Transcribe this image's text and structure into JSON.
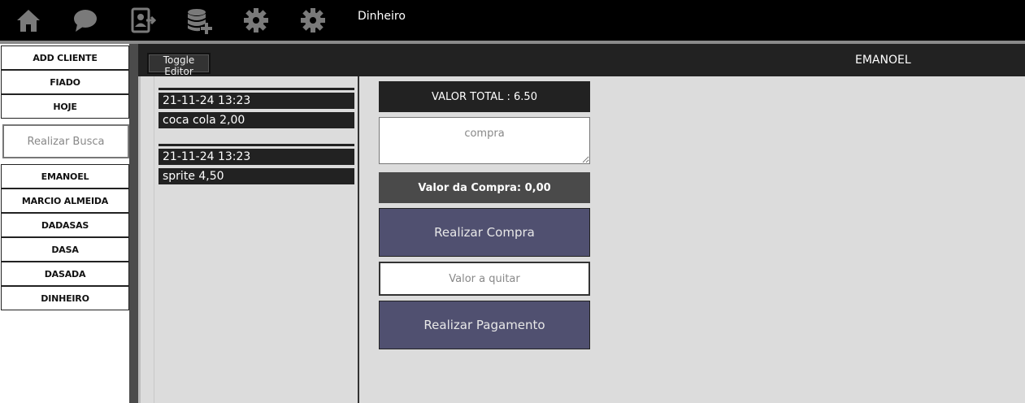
{
  "topbar": {
    "title": "Dinheiro",
    "icons": [
      "home-icon",
      "chat-icon",
      "user-export-icon",
      "database-add-icon",
      "gear-icon",
      "gear-icon"
    ]
  },
  "sidebar": {
    "buttons": [
      "ADD CLIENTE",
      "FIADO",
      "HOJE"
    ],
    "search_placeholder": "Realizar Busca",
    "clients": [
      "EMANOEL",
      "MARCIO ALMEIDA",
      "DADASAS",
      "DASA",
      "DASADA",
      "DINHEIRO"
    ]
  },
  "header": {
    "toggle_label": "Toggle Editor",
    "client_name": "EMANOEL"
  },
  "history": [
    {
      "date": "21-11-24 13:23",
      "item": "coca cola 2,00"
    },
    {
      "date": "21-11-24 13:23",
      "item": "sprite 4,50"
    }
  ],
  "panel": {
    "total": "VALOR TOTAL : 6.50",
    "compra_placeholder": "compra",
    "valor_compra": "Valor da Compra: 0,00",
    "realizar_compra": "Realizar Compra",
    "quitar_placeholder": "Valor a quitar",
    "realizar_pagamento": "Realizar Pagamento"
  },
  "colors": {
    "topbar": "#000000",
    "header": "#222222",
    "accent_button": "#505070",
    "background": "#dcdcdc"
  }
}
